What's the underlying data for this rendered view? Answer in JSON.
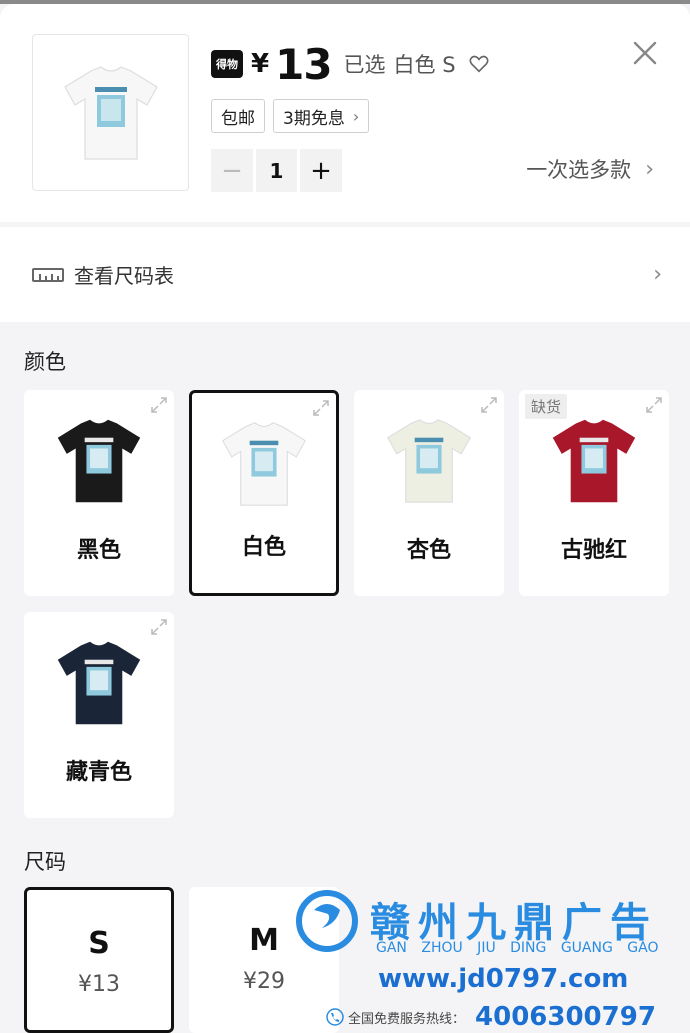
{
  "header": {
    "badge": "得物",
    "currency": "¥",
    "price": "13",
    "selected_prefix": "已选",
    "selected_value": "白色 S",
    "tags": [
      {
        "label": "包邮",
        "has_chevron": false
      },
      {
        "label": "3期免息",
        "has_chevron": true
      }
    ],
    "quantity": "1",
    "multi_select_label": "一次选多款"
  },
  "size_chart": {
    "label": "查看尺码表"
  },
  "colors": {
    "title": "颜色",
    "items": [
      {
        "label": "黑色",
        "shirt_color": "#1a1a1a",
        "selected": false,
        "out_of_stock": false
      },
      {
        "label": "白色",
        "shirt_color": "#f7f7f7",
        "selected": true,
        "out_of_stock": false
      },
      {
        "label": "杏色",
        "shirt_color": "#ecefe2",
        "selected": false,
        "out_of_stock": false
      },
      {
        "label": "古驰红",
        "shirt_color": "#a8182a",
        "selected": false,
        "out_of_stock": true
      },
      {
        "label": "藏青色",
        "shirt_color": "#1b2538",
        "selected": false,
        "out_of_stock": false
      }
    ],
    "out_of_stock_label": "缺货"
  },
  "sizes": {
    "title": "尺码",
    "items": [
      {
        "size": "S",
        "price": "¥13",
        "selected": true
      },
      {
        "size": "M",
        "price": "¥29",
        "selected": false
      }
    ]
  },
  "watermark": {
    "title": "赣州九鼎广告",
    "pinyin": "GAN ZHOU JIU DING GUANG GAO",
    "url": "www.jd0797.com",
    "hotline_label": "全国免费服务热线：",
    "hotline_number": "4006300797"
  },
  "icons": [
    "dewu-badge-icon",
    "heart-icon",
    "close-icon",
    "chevron-right-icon",
    "ruler-icon",
    "expand-icon",
    "phone-icon"
  ],
  "colors_theme": {
    "selected_border": "#111111",
    "watermark_blue": "#2a8ce0"
  }
}
